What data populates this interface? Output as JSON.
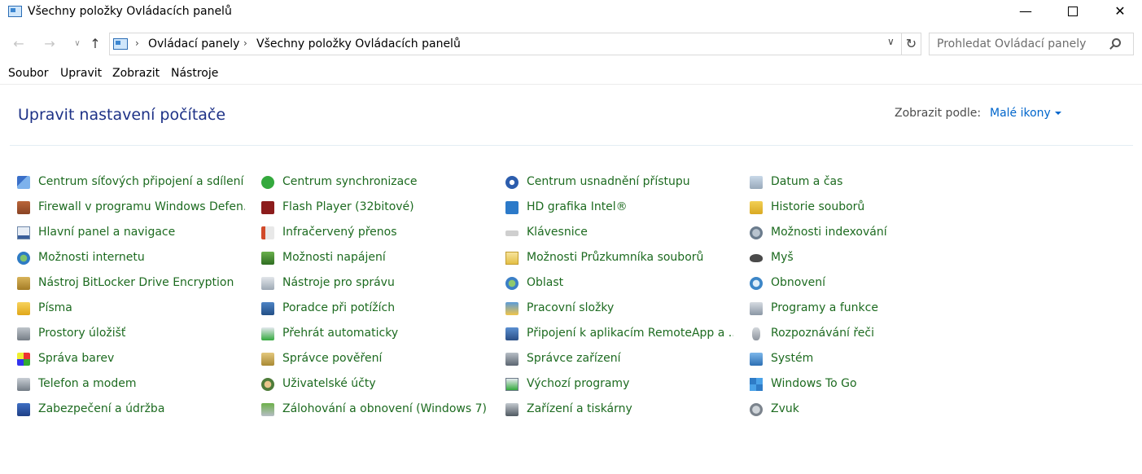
{
  "window": {
    "title": "Všechny položky Ovládacích panelů",
    "minimize_glyph": "—",
    "close_glyph": "✕"
  },
  "nav": {
    "back_glyph": "←",
    "forward_glyph": "→",
    "recent_glyph": "∨",
    "up_glyph": "↑",
    "refresh_glyph": "↻",
    "dropdown_glyph": "∨",
    "breadcrumb": [
      "Ovládací panely",
      "Všechny položky Ovládacích panelů"
    ],
    "separator": "›",
    "search_placeholder": "Prohledat Ovládací panely"
  },
  "menu": [
    "Soubor",
    "Upravit",
    "Zobrazit",
    "Nástroje"
  ],
  "content": {
    "title": "Upravit nastavení počítače",
    "view_by_label": "Zobrazit podle:",
    "view_by_value": "Malé ikony"
  },
  "items": [
    [
      {
        "label": "Centrum síťových připojení a sdílení",
        "icon": "network-icon"
      },
      {
        "label": "Firewall v programu Windows Defen...",
        "icon": "firewall-icon"
      },
      {
        "label": "Hlavní panel a navigace",
        "icon": "taskbar-icon"
      },
      {
        "label": "Možnosti internetu",
        "icon": "internet-icon"
      },
      {
        "label": "Nástroj BitLocker Drive Encryption",
        "icon": "bitlocker-icon"
      },
      {
        "label": "Písma",
        "icon": "fonts-icon"
      },
      {
        "label": "Prostory úložišť",
        "icon": "storage-icon"
      },
      {
        "label": "Správa barev",
        "icon": "color-icon"
      },
      {
        "label": "Telefon a modem",
        "icon": "phone-icon"
      },
      {
        "label": "Zabezpečení a údržba",
        "icon": "security-icon"
      }
    ],
    [
      {
        "label": "Centrum synchronizace",
        "icon": "sync-icon"
      },
      {
        "label": "Flash Player (32bitové)",
        "icon": "flash-icon"
      },
      {
        "label": "Infračervený přenos",
        "icon": "infrared-icon"
      },
      {
        "label": "Možnosti napájení",
        "icon": "power-icon"
      },
      {
        "label": "Nástroje pro správu",
        "icon": "admin-icon"
      },
      {
        "label": "Poradce při potížích",
        "icon": "troubleshoot-icon"
      },
      {
        "label": "Přehrát automaticky",
        "icon": "autoplay-icon"
      },
      {
        "label": "Správce pověření",
        "icon": "credential-icon"
      },
      {
        "label": "Uživatelské účty",
        "icon": "users-icon"
      },
      {
        "label": "Zálohování a obnovení (Windows 7)",
        "icon": "backup-icon"
      }
    ],
    [
      {
        "label": "Centrum usnadnění přístupu",
        "icon": "ease-icon"
      },
      {
        "label": "HD grafika Intel®",
        "icon": "intel-icon"
      },
      {
        "label": "Klávesnice",
        "icon": "keyboard-icon"
      },
      {
        "label": "Možnosti Průzkumníka souborů",
        "icon": "folderopt-icon"
      },
      {
        "label": "Oblast",
        "icon": "region-icon"
      },
      {
        "label": "Pracovní složky",
        "icon": "workfolders-icon"
      },
      {
        "label": "Připojení k aplikacím RemoteApp a ...",
        "icon": "remoteapp-icon"
      },
      {
        "label": "Správce zařízení",
        "icon": "devmgr-icon"
      },
      {
        "label": "Výchozí programy",
        "icon": "default-icon"
      },
      {
        "label": "Zařízení a tiskárny",
        "icon": "printers-icon"
      }
    ],
    [
      {
        "label": "Datum a čas",
        "icon": "clock-icon"
      },
      {
        "label": "Historie souborů",
        "icon": "history-icon"
      },
      {
        "label": "Možnosti indexování",
        "icon": "index-icon"
      },
      {
        "label": "Myš",
        "icon": "mouse-icon"
      },
      {
        "label": "Obnovení",
        "icon": "recovery-icon"
      },
      {
        "label": "Programy a funkce",
        "icon": "programs-icon"
      },
      {
        "label": "Rozpoznávání řeči",
        "icon": "speech-icon"
      },
      {
        "label": "Systém",
        "icon": "system-icon"
      },
      {
        "label": "Windows To Go",
        "icon": "wintogo-icon"
      },
      {
        "label": "Zvuk",
        "icon": "sound-icon"
      }
    ]
  ]
}
